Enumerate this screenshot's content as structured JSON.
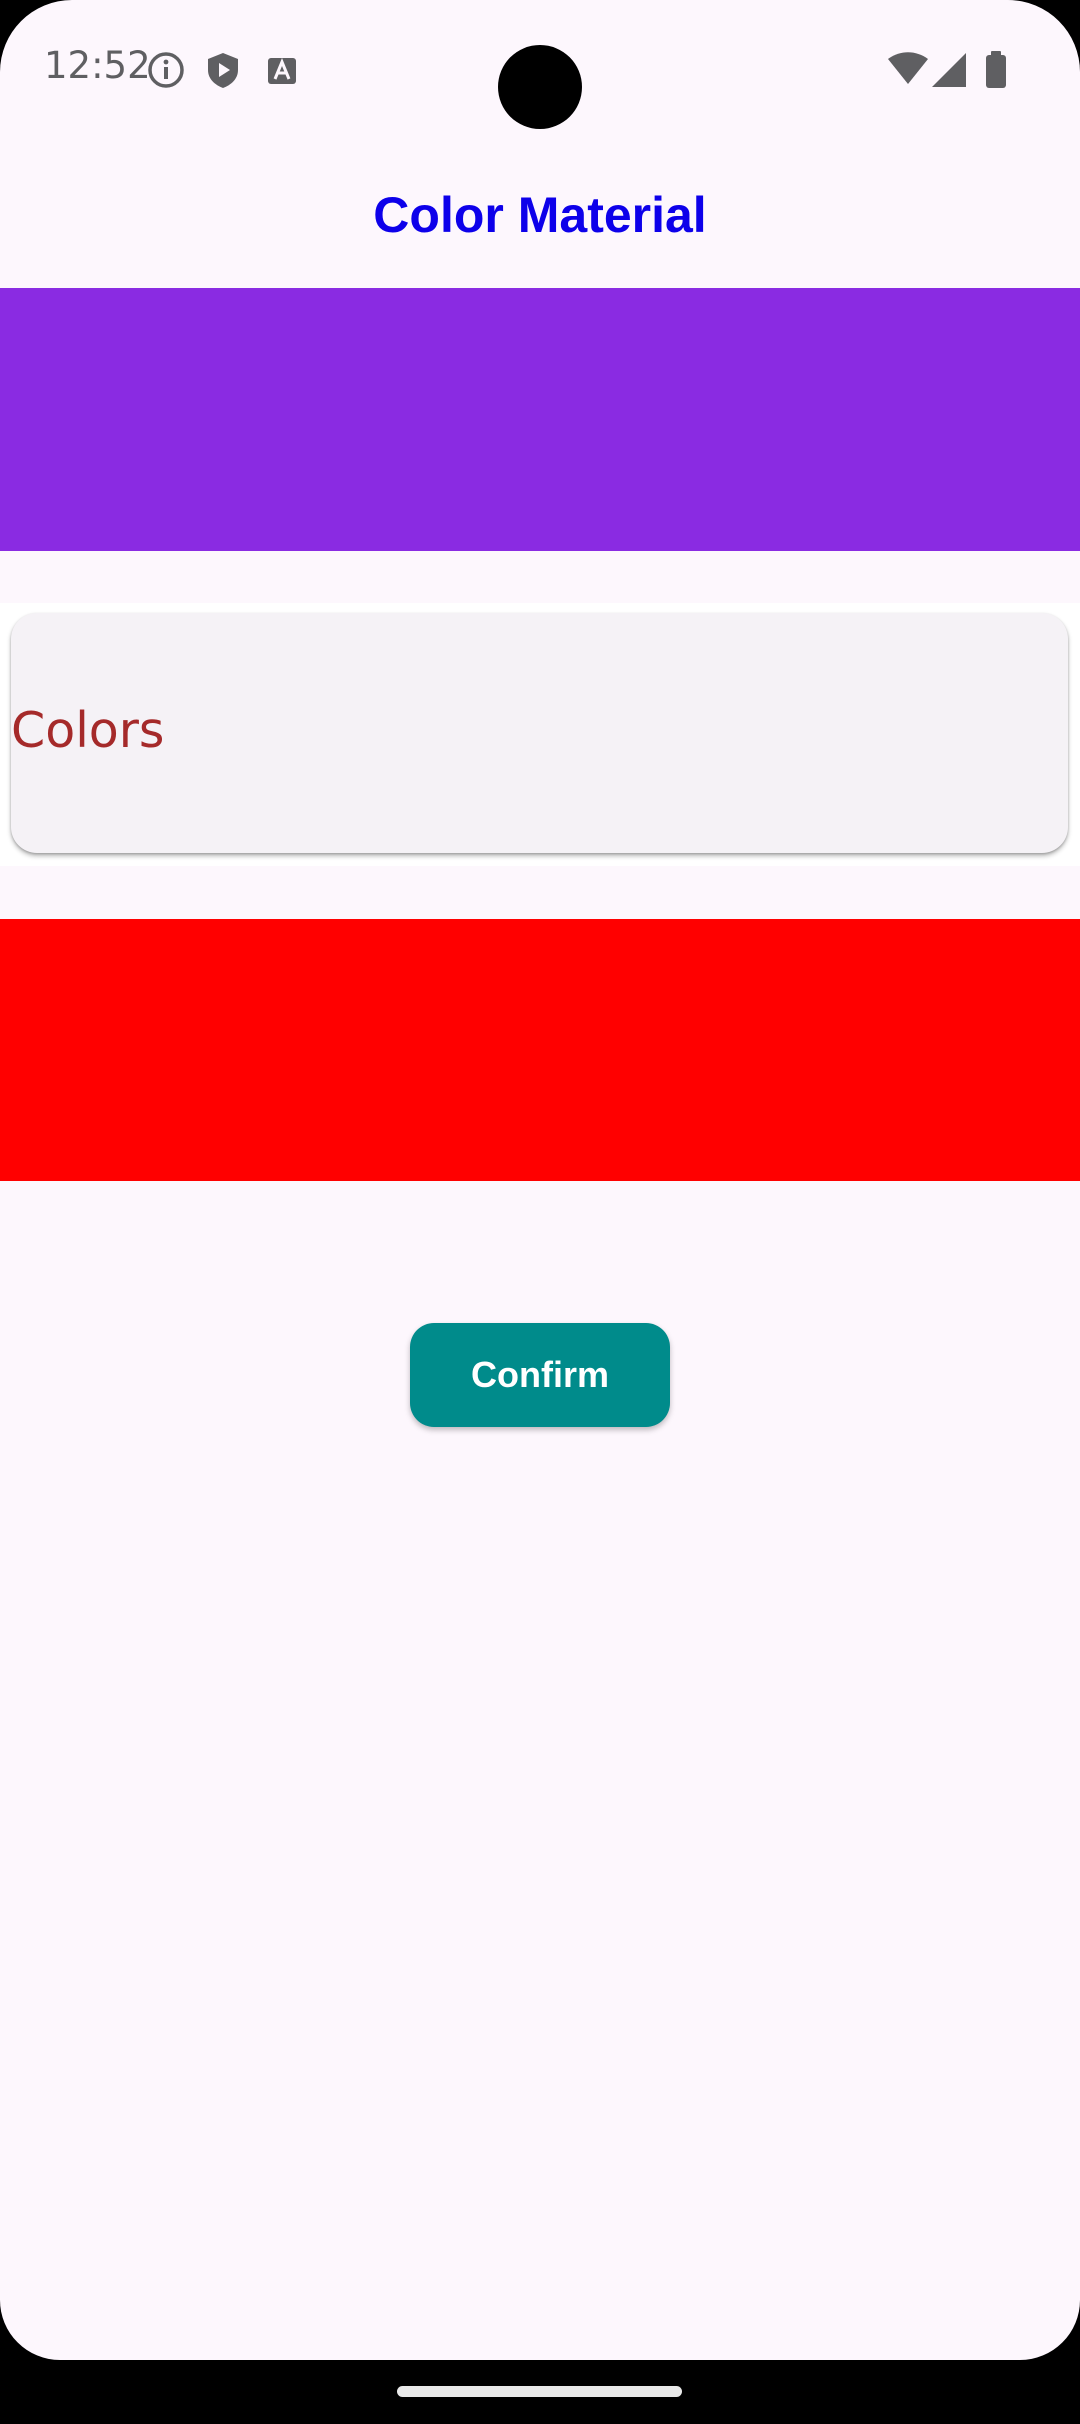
{
  "status_bar": {
    "time": "12:52",
    "left_icons": [
      "info-icon",
      "shield-play-icon",
      "text-a-icon"
    ],
    "right_icons": [
      "wifi-icon",
      "cellular-signal-icon",
      "battery-icon"
    ]
  },
  "app_bar": {
    "title": "Color Material",
    "title_color": "#0d00ea"
  },
  "blocks": {
    "top_color": "#8a2be2",
    "bottom_color": "#ff0000"
  },
  "card": {
    "label": "Colors",
    "label_color": "#a52a2a"
  },
  "confirm_button": {
    "label": "Confirm",
    "background": "#008b8b"
  }
}
